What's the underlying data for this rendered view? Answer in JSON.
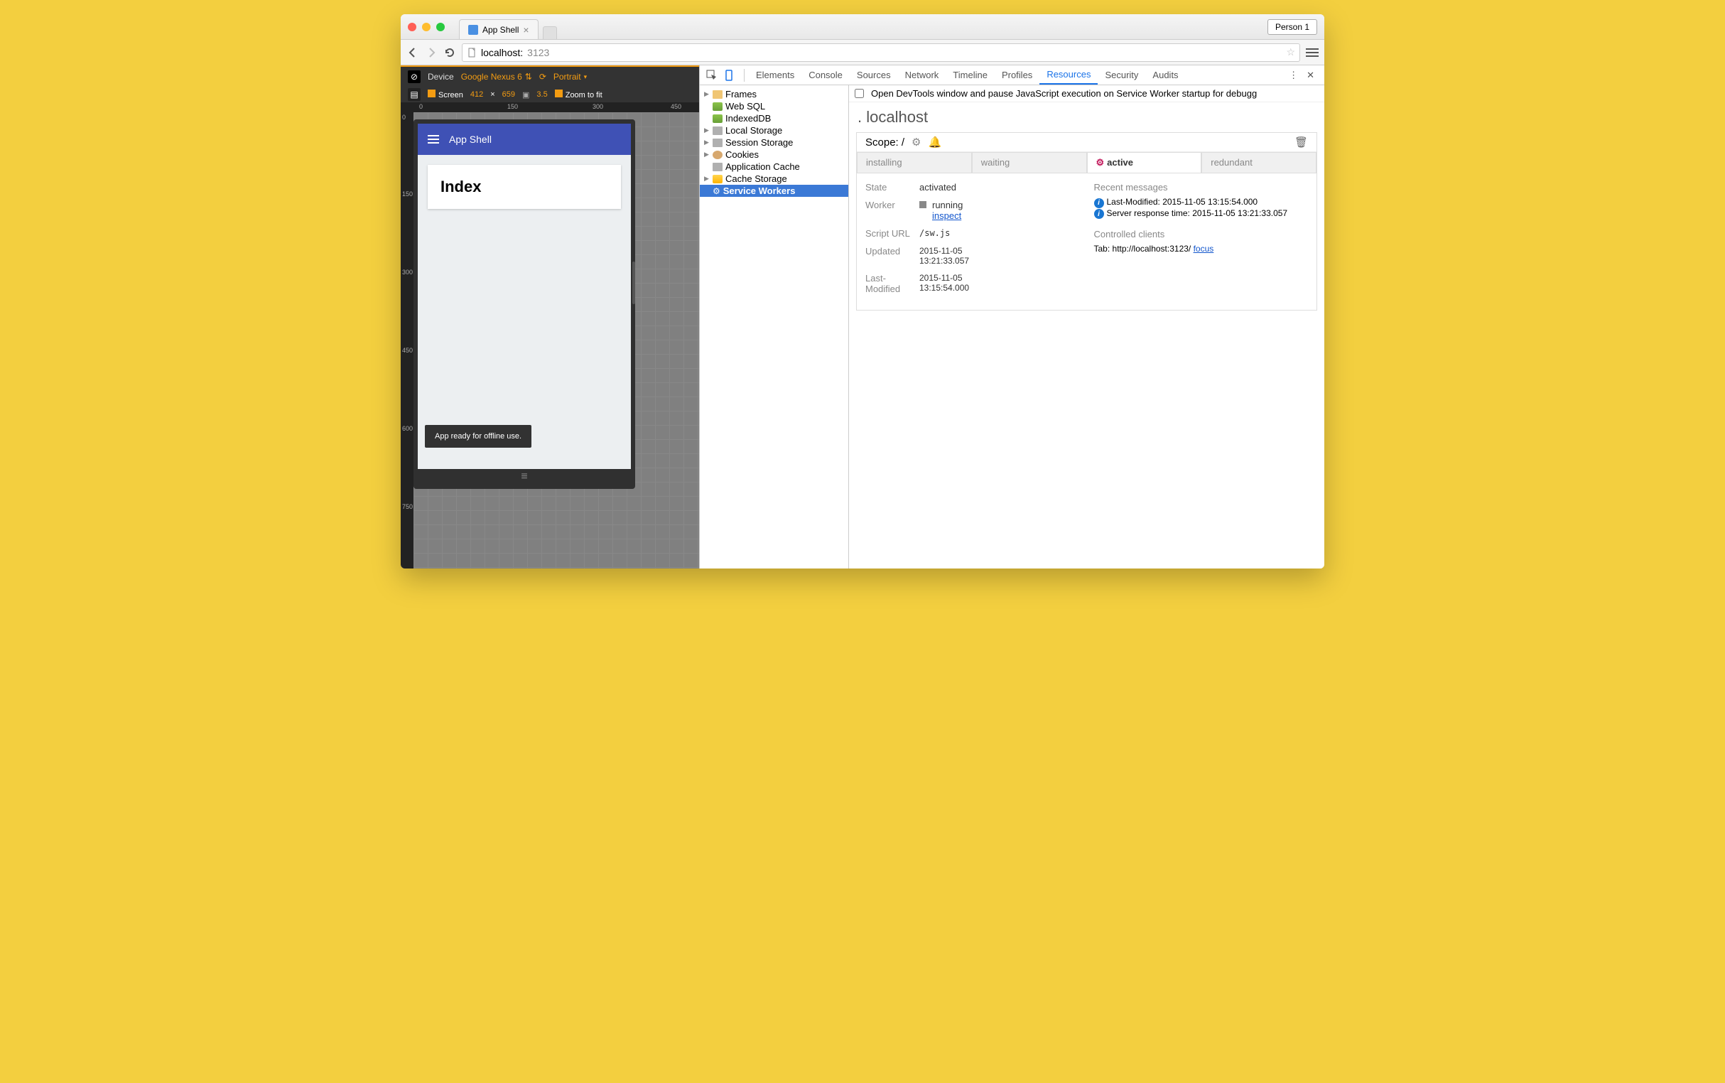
{
  "browser": {
    "tab_title": "App Shell",
    "person": "Person 1",
    "url_host": "localhost:",
    "url_port": "3123"
  },
  "device": {
    "label": "Device",
    "model": "Google Nexus 6",
    "orientation": "Portrait",
    "screen_label": "Screen",
    "width": "412",
    "height": "659",
    "dpr": "3.5",
    "zoom": "Zoom to fit",
    "ruler_h": [
      "0",
      "150",
      "300",
      "450"
    ],
    "ruler_v": [
      "0",
      "150",
      "300",
      "450",
      "600",
      "750"
    ]
  },
  "app": {
    "header": "App Shell",
    "card": "Index",
    "toast": "App ready for offline use."
  },
  "devtools": {
    "tabs": [
      "Elements",
      "Console",
      "Sources",
      "Network",
      "Timeline",
      "Profiles",
      "Resources",
      "Security",
      "Audits"
    ],
    "active_tab": "Resources",
    "checkbox_label": "Open DevTools window and pause JavaScript execution on Service Worker startup for debugg",
    "tree": [
      "Frames",
      "Web SQL",
      "IndexedDB",
      "Local Storage",
      "Session Storage",
      "Cookies",
      "Application Cache",
      "Cache Storage",
      "Service Workers"
    ],
    "host": "localhost",
    "scope_label": "Scope: ",
    "scope_path": "/",
    "sw_tabs": [
      "installing",
      "waiting",
      "active",
      "redundant"
    ],
    "details": {
      "state_k": "State",
      "state_v": "activated",
      "worker_k": "Worker",
      "worker_status": "running",
      "worker_link": "inspect",
      "script_k": "Script URL",
      "script_v": "/sw.js",
      "updated_k": "Updated",
      "updated_v1": "2015-11-05",
      "updated_v2": "13:21:33.057",
      "lastmod_k": "Last-Modified",
      "lastmod_v1": "2015-11-05",
      "lastmod_v2": "13:15:54.000"
    },
    "messages": {
      "head": "Recent messages",
      "m1": "Last-Modified: 2015-11-05 13:15:54.000",
      "m2": "Server response time: 2015-11-05 13:21:33.057",
      "clients_head": "Controlled clients",
      "client_prefix": "Tab: http://localhost:3123/ ",
      "client_link": "focus"
    }
  }
}
